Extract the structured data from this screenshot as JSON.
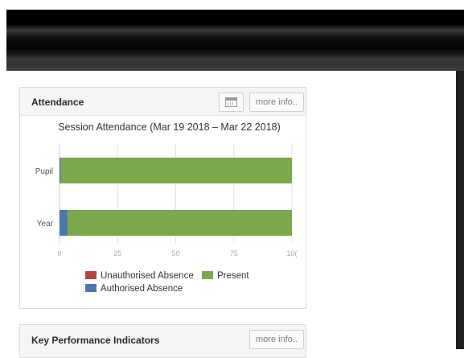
{
  "attendance_panel": {
    "title": "Attendance",
    "more_info_label": "more info..",
    "calendar_icon": "calendar-icon"
  },
  "chart_data": {
    "type": "bar",
    "orientation": "horizontal",
    "stacked": true,
    "title": "Session Attendance (Mar 19 2018 – Mar 22 2018)",
    "categories": [
      "Pupil",
      "Year"
    ],
    "x_ticks": [
      "0",
      "25",
      "50",
      "75",
      "10("
    ],
    "xlim": [
      0,
      100
    ],
    "grid": true,
    "legend_position": "bottom",
    "series": [
      {
        "name": "Unauthorised Absence",
        "color": "#b84343",
        "values": [
          0,
          0
        ]
      },
      {
        "name": "Authorised Absence",
        "color": "#4a79b2",
        "values": [
          0.5,
          3.5
        ]
      },
      {
        "name": "Present",
        "color": "#7aa84a",
        "values": [
          99.5,
          96.5
        ]
      }
    ]
  },
  "kpi_panel": {
    "title": "Key Performance Indicators",
    "more_info_label": "more info.."
  }
}
